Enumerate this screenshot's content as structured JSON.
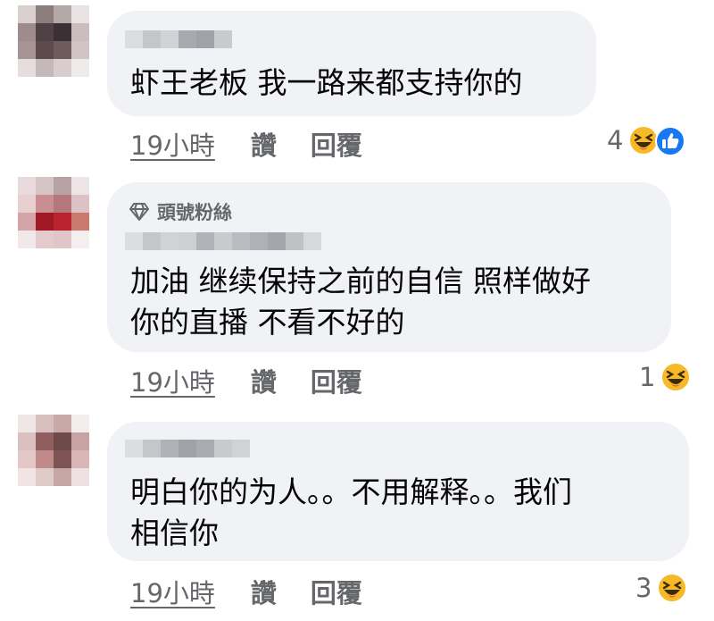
{
  "comments": [
    {
      "badge": "",
      "text_lines": [
        "虾王老板 我一路来都支持你的"
      ],
      "time": "19小時",
      "like_label": "讚",
      "reply_label": "回覆",
      "reaction_count": "4",
      "reactions": [
        "haha-icon",
        "like-icon"
      ]
    },
    {
      "badge": "頭號粉絲",
      "text_lines": [
        "加油 继续保持之前的自信 照样做好",
        "你的直播 不看不好的"
      ],
      "time": "19小時",
      "like_label": "讚",
      "reply_label": "回覆",
      "reaction_count": "1",
      "reactions": [
        "haha-icon"
      ]
    },
    {
      "badge": "",
      "text_lines": [
        "明白你的为人。。不用解释。。我们",
        "相信你"
      ],
      "time": "19小時",
      "like_label": "讚",
      "reply_label": "回覆",
      "reaction_count": "3",
      "reactions": [
        "haha-icon"
      ]
    }
  ],
  "colors": {
    "bubble": "#f0f2f5",
    "meta_text": "#65676b",
    "comment_text": "#050505",
    "like_blue": "#1877f2",
    "emoji_yellow": "#f7b928"
  }
}
